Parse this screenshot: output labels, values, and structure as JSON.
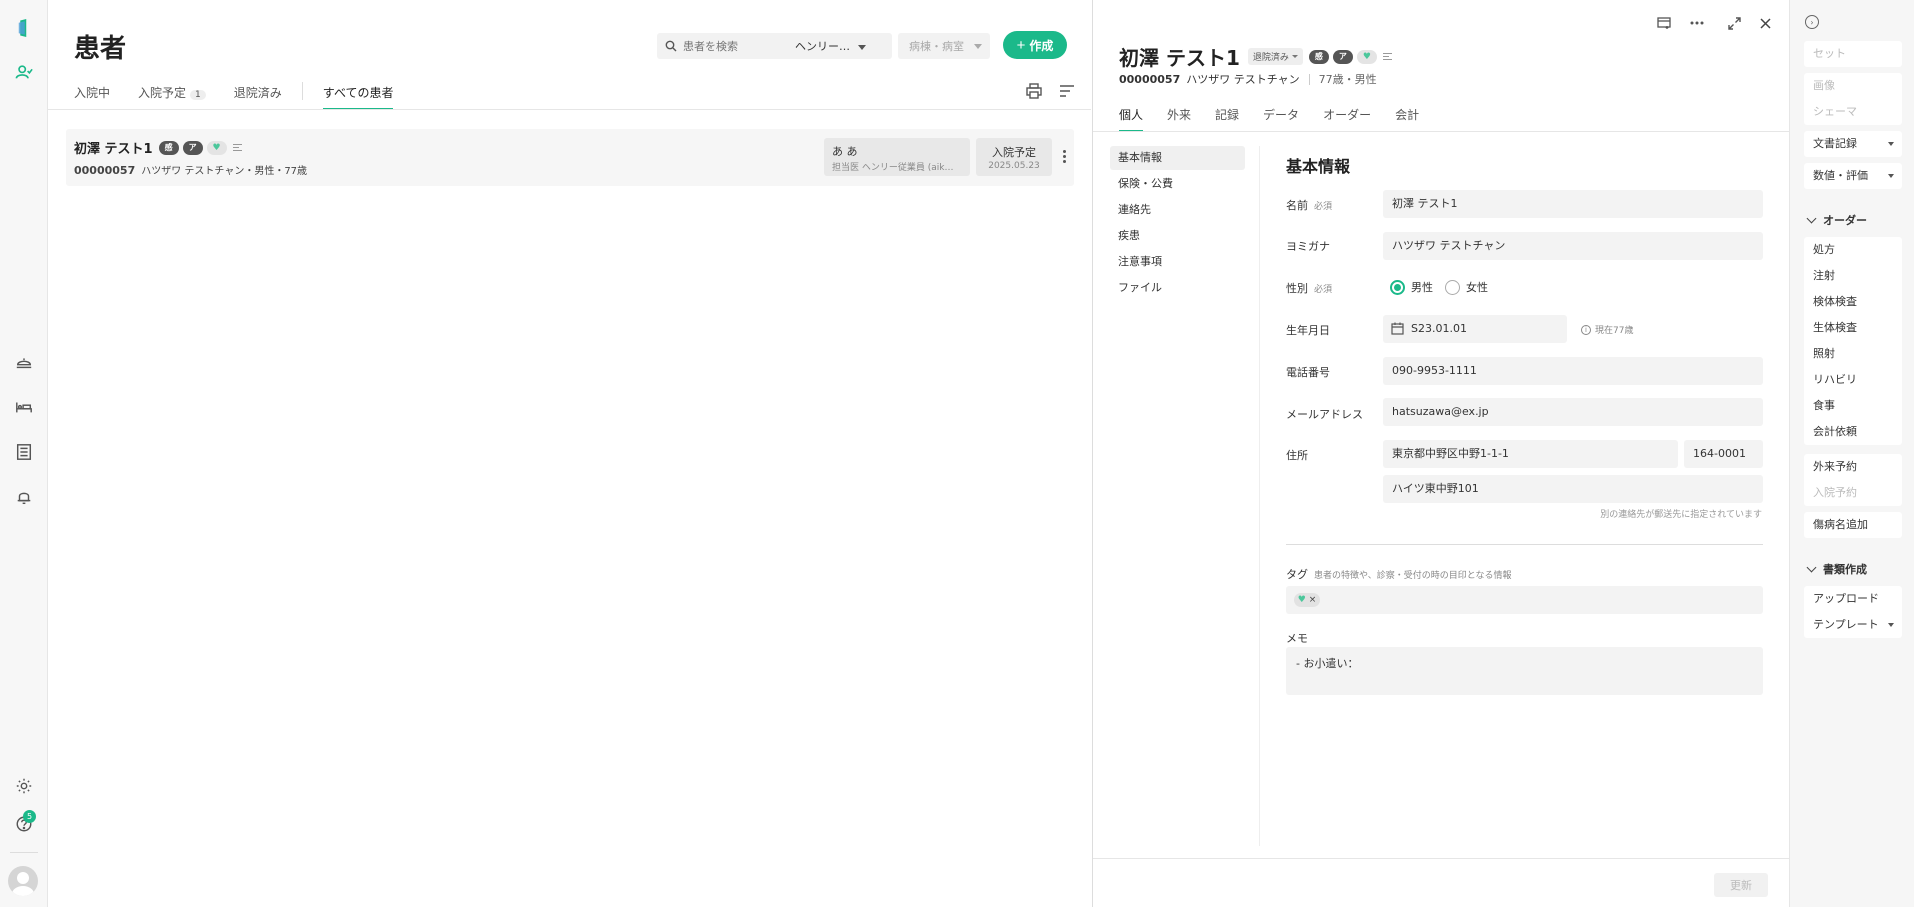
{
  "rail": {
    "help_badge": "5"
  },
  "main": {
    "title": "患者",
    "search": {
      "placeholder": "患者を検索",
      "selected": "ヘンリー…"
    },
    "ward_placeholder": "病棟・病室",
    "create_label": "作成",
    "tabs": [
      {
        "label": "入院中"
      },
      {
        "label": "入院予定",
        "count": "1"
      },
      {
        "label": "退院済み"
      },
      {
        "label": "すべての患者"
      }
    ],
    "patient": {
      "name": "初澤 テスト1",
      "chip1": "感",
      "chip2": "ア",
      "id": "00000057",
      "info": "ハツザワ テストチャン・男性・77歳",
      "doc_name": "あ あ",
      "doc_info": "担当医 ヘンリー従業員 (aik…",
      "adm_status": "入院予定",
      "adm_date": "2025.05.23"
    }
  },
  "detail": {
    "name": "初澤 テスト1",
    "status": "退院済み",
    "chip1": "感",
    "chip2": "ア",
    "id": "00000057",
    "kana": "ハツザワ テストチャン",
    "age": "77歳・男性",
    "tabs": [
      "個人",
      "外来",
      "記録",
      "データ",
      "オーダー",
      "会計"
    ],
    "nav": [
      "基本情報",
      "保険・公費",
      "連絡先",
      "疾患",
      "注意事項",
      "ファイル"
    ],
    "section": "基本情報",
    "labels": {
      "name": "名前",
      "kana": "ヨミガナ",
      "sex": "性別",
      "birth": "生年月日",
      "phone": "電話番号",
      "email": "メールアドレス",
      "address": "住所",
      "tag": "タグ",
      "memo": "メモ"
    },
    "required": "必須",
    "values": {
      "name": "初澤 テスト1",
      "kana": "ハツザワ テストチャン",
      "male": "男性",
      "female": "女性",
      "birth": "S23.01.01",
      "age_hint": "現在77歳",
      "phone": "090-9953-1111",
      "email": "hatsuzawa@ex.jp",
      "address1": "東京都中野区中野1-1-1",
      "zip": "164-0001",
      "address2": "ハイツ東中野101"
    },
    "address_note": "別の連絡先が郵送先に指定されています",
    "tag_hint": "患者の特徴や、診察・受付の時の目印となる情報",
    "memo": "- お小遣い：",
    "update_label": "更新"
  },
  "sidebar": {
    "set": "セット",
    "image": "画像",
    "schema": "シェーマ",
    "doc_record": "文書記録",
    "values_eval": "数値・評価",
    "order_head": "オーダー",
    "orders": [
      "処方",
      "注射",
      "検体検査",
      "生体検査",
      "照射",
      "リハビリ",
      "食事",
      "会計依頼"
    ],
    "outpatient_booking": "外来予約",
    "admission_booking": "入院予約",
    "add_diagnosis": "傷病名追加",
    "docs_head": "書類作成",
    "upload": "アップロード",
    "template": "テンプレート"
  },
  "colors": {
    "accent": "#1bb98a"
  }
}
